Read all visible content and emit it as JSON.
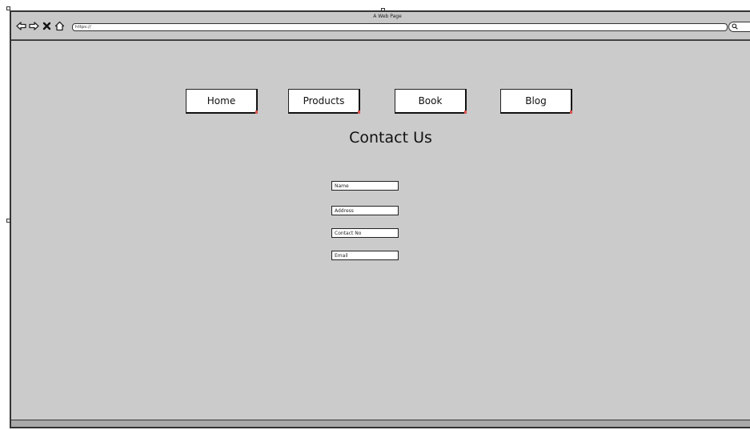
{
  "browser": {
    "window_title": "A Web Page",
    "url": "https://",
    "icons": [
      "back-icon",
      "forward-icon",
      "close-icon",
      "home-icon",
      "search-icon"
    ]
  },
  "nav": {
    "items": [
      {
        "label": "Home"
      },
      {
        "label": "Products"
      },
      {
        "label": "Book"
      },
      {
        "label": "Blog"
      }
    ]
  },
  "page": {
    "heading": "Contact Us"
  },
  "form": {
    "fields": [
      {
        "placeholder": "Name"
      },
      {
        "placeholder": "Address"
      },
      {
        "placeholder": "Contact No"
      },
      {
        "placeholder": "Email"
      }
    ]
  },
  "colors": {
    "canvas_bg": "#cbcbcb",
    "border": "#333333",
    "button_bg": "#ffffff",
    "button_corner": "#d9534f"
  }
}
